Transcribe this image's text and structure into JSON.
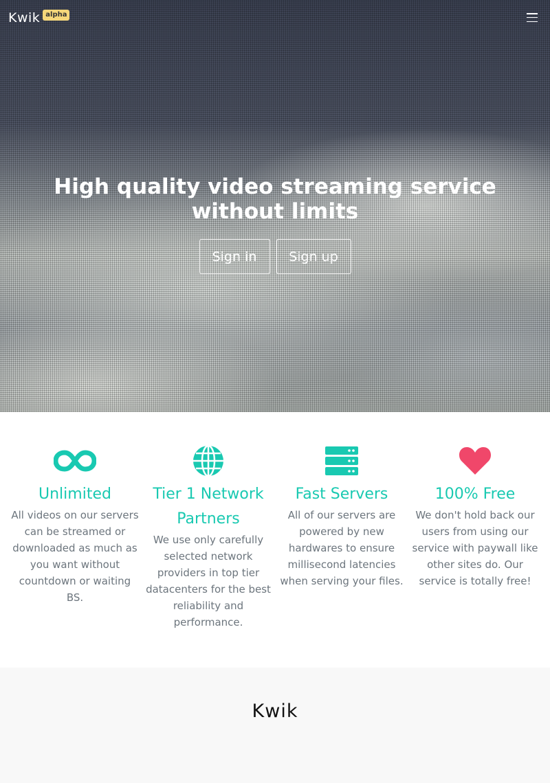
{
  "header": {
    "brand": "Kwik",
    "badge": "alpha"
  },
  "hero": {
    "title": "High quality video streaming service without limits",
    "signin_label": "Sign in",
    "signup_label": "Sign up"
  },
  "features": [
    {
      "icon": "infinity-icon",
      "title": "Unlimited",
      "text": "All videos on our servers can be streamed or downloaded as much as you want without countdown or waiting BS."
    },
    {
      "icon": "globe-icon",
      "title": "Tier 1 Network Partners",
      "text": "We use only carefully selected network providers in top tier datacenters for the best reliability and performance."
    },
    {
      "icon": "server-icon",
      "title": "Fast Servers",
      "text": "All of our servers are powered by new hardwares to ensure millisecond latencies when serving your files."
    },
    {
      "icon": "heart-icon",
      "title": "100% Free",
      "text": "We don't hold back our users from using our service with paywall like other sites do. Our service is totally free!"
    }
  ],
  "footer": {
    "brand": "Kwik"
  },
  "colors": {
    "accent": "#19c9b1",
    "heart": "#f0476a",
    "badge": "#f5d77a"
  }
}
